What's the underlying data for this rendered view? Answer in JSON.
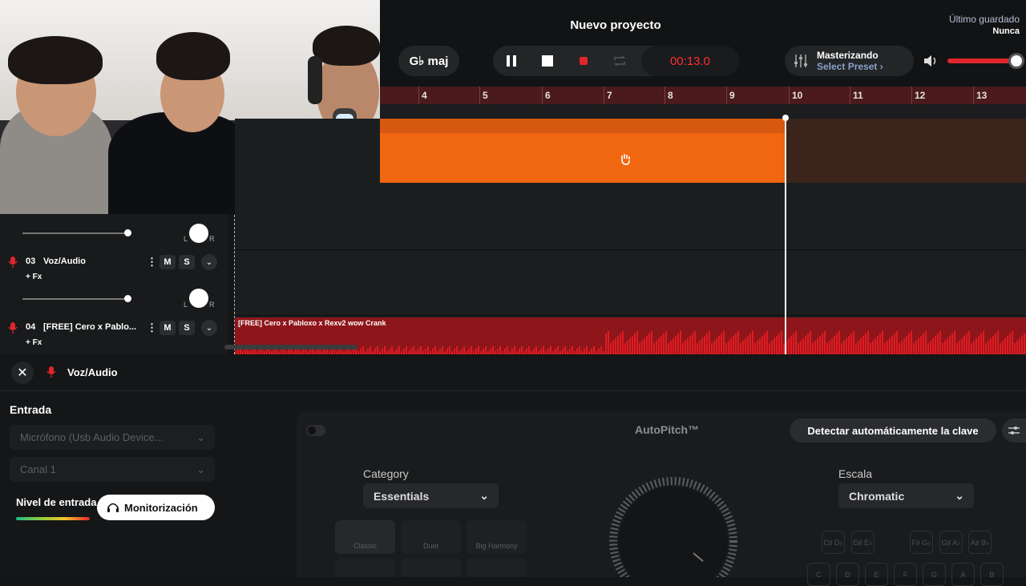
{
  "header": {
    "project_title": "Nuevo proyecto",
    "saved_label": "Último guardado",
    "saved_value": "Nunca",
    "key_label": "G♭ maj",
    "time": "00:13.0",
    "mastering_title": "Masterizando",
    "mastering_preset": "Select Preset ›"
  },
  "ruler": {
    "ticks": [
      "4",
      "5",
      "6",
      "7",
      "8",
      "9",
      "10",
      "11",
      "12",
      "13"
    ]
  },
  "tracks": [
    {
      "number": "03",
      "name": "Voz/Audio",
      "fx": "+ Fx",
      "mute": "M",
      "solo": "S"
    },
    {
      "number": "04",
      "name": "[FREE] Cero x Pablo...",
      "fx": "+ Fx",
      "mute": "M",
      "solo": "S"
    }
  ],
  "knob_labels": {
    "left": "L",
    "right": "R"
  },
  "audio_clip_name": "[FREE] Cero x Pabloxo x Rexv2 wow  Crank",
  "panel": {
    "track_title": "Voz/Audio",
    "input_heading": "Entrada",
    "input_device": "Micrófono (Usb Audio Device...",
    "input_channel": "Canal 1",
    "input_level_label": "Nivel de entrada",
    "monitor_button": "Monitorización"
  },
  "autopitch": {
    "title": "AutoPitch™",
    "detect_button": "Detectar automáticamente la clave",
    "category_label": "Category",
    "category_value": "Essentials",
    "scale_label": "Escala",
    "scale_value": "Chromatic",
    "modes": [
      "Classic",
      "Duet",
      "Big Harmony"
    ],
    "keys_top": [
      "C♯ D♭",
      "D♯ E♭",
      "F♯ G♭",
      "G♯ A♭",
      "A♯ B♭"
    ],
    "keys_bottom": [
      "C",
      "D",
      "E",
      "F",
      "G",
      "A",
      "B"
    ]
  },
  "colors": {
    "accent_orange": "#f06611",
    "record_red": "#ff2f2f",
    "audio_red": "#e01b22"
  }
}
